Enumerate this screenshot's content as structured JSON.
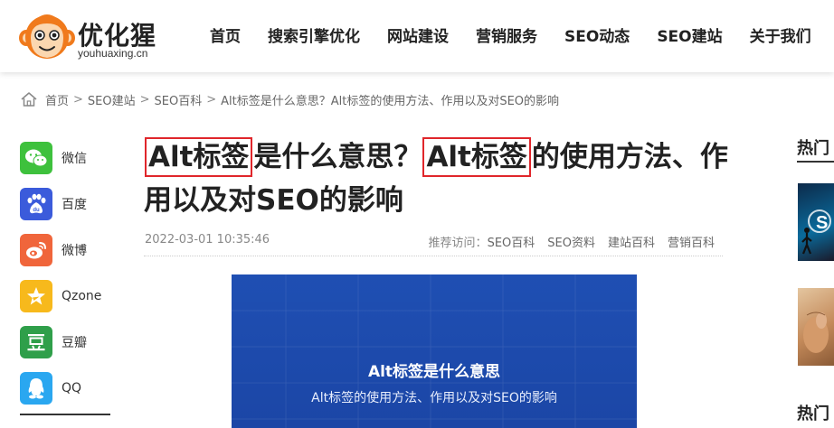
{
  "header": {
    "logo_cn": "优化猩",
    "logo_en": "youhuaxing.cn",
    "nav": [
      "首页",
      "搜索引擎优化",
      "网站建设",
      "营销服务",
      "SEO动态",
      "SEO建站",
      "关于我们"
    ]
  },
  "breadcrumb": {
    "items": [
      "首页",
      "SEO建站",
      "SEO百科"
    ],
    "current": "Alt标签是什么意思？Alt标签的使用方法、作用以及对SEO的影响"
  },
  "share": {
    "items": [
      {
        "label": "微信",
        "icon": "wechat-icon",
        "color": "#3ec13d"
      },
      {
        "label": "百度",
        "icon": "baidu-icon",
        "color": "#3b5bdb"
      },
      {
        "label": "微博",
        "icon": "weibo-icon",
        "color": "#f0653b"
      },
      {
        "label": "Qzone",
        "icon": "qzone-icon",
        "color": "#f7b91c"
      },
      {
        "label": "豆瓣",
        "icon": "douban-icon",
        "color": "#2f9f4a"
      },
      {
        "label": "QQ",
        "icon": "qq-icon",
        "color": "#2aa7f0"
      }
    ]
  },
  "article": {
    "title_hl1": "Alt标签",
    "title_mid": "是什么意思？",
    "title_hl2": "Alt标签",
    "title_rest": "的使用方法、作用以及对SEO的影响",
    "date": "2022-03-01 10:35:46",
    "recommend_label": "推荐访问：",
    "tags": [
      "SEO百科",
      "SEO资料",
      "建站百科",
      "营销百科"
    ],
    "feature_title": "Alt标签是什么意思",
    "feature_subtitle": "Alt标签的使用方法、作用以及对SEO的影响"
  },
  "sidebar_right": {
    "hot_title": "热门",
    "hot_title2": "热门"
  },
  "colors": {
    "highlight_border": "#e0262b",
    "feature_bg": "#1f4fb3"
  }
}
